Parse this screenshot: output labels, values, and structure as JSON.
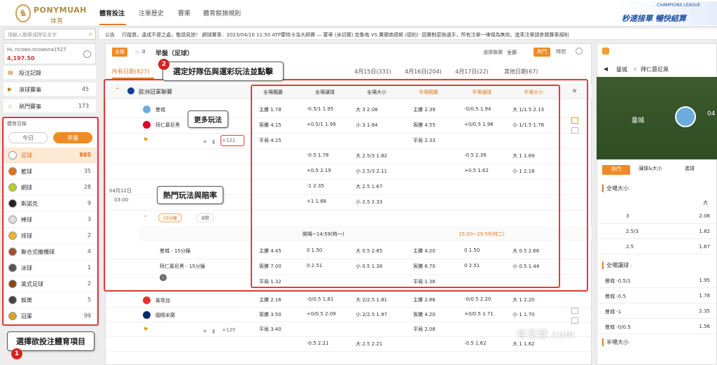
{
  "nav": {
    "brand": "PONYMUAH",
    "brand_sub": "体育",
    "links": [
      "體育投注",
      "注單歷史",
      "賽果",
      "體育競猜規則"
    ],
    "promo_text": "秒速接單 暢快結算",
    "promo_badge": "CHAMPIONS LEAGUE"
  },
  "search": {
    "placeholder": "請輸入聯賽或隊伍名字"
  },
  "announcement": {
    "label": "公告",
    "text": "行蹤異，違成不便之處，敬請見諒！  網球賽事：2023/04/10 11:50 ATP蒙特卡洛大師賽 — 蒙蒂 (米切爾) 克魯格 VS 費爾南德斯 (德約) ·因賽制更換選手，所有注單一律視為無效。進率注單請參閱賽事規則"
  },
  "user": {
    "name": "Hi, ncows-ncowsnа1527",
    "balance": "4,197.50"
  },
  "sidebar": {
    "items": [
      {
        "label": "投注記錄",
        "count": ""
      },
      {
        "label": "滾球賽事",
        "count": "45"
      },
      {
        "label": "熱門賽事",
        "count": "173"
      }
    ],
    "sports_title": "體育目錄",
    "toggle_today": "今日",
    "toggle_early": "早盤",
    "sports": [
      {
        "label": "足球",
        "count": "885",
        "color": "#ffffff"
      },
      {
        "label": "籃球",
        "count": "35",
        "color": "#e0721a"
      },
      {
        "label": "網球",
        "count": "28",
        "color": "#b6d12b"
      },
      {
        "label": "斯諾克",
        "count": "9",
        "color": "#222222"
      },
      {
        "label": "棒球",
        "count": "3",
        "color": "#dddddd"
      },
      {
        "label": "排球",
        "count": "2",
        "color": "#f0b429"
      },
      {
        "label": "聯合式橄欖球",
        "count": "4",
        "color": "#a0522d"
      },
      {
        "label": "冰球",
        "count": "1",
        "color": "#555555"
      },
      {
        "label": "美式足球",
        "count": "2",
        "color": "#8b4513"
      },
      {
        "label": "娛樂",
        "count": "5",
        "color": "#444444"
      },
      {
        "label": "冠軍",
        "count": "99",
        "color": "#d9a520"
      }
    ]
  },
  "main": {
    "tab_all": "全部",
    "star_count": "0",
    "section_title": "早盤（足球）",
    "sort_label": "選擇聯賽",
    "sort_value": "全部",
    "hot_btn": "熱門",
    "time_btn": "時間",
    "date_tabs": [
      "所有日期(827)",
      "4月15日(331)",
      "4月16日(204)",
      "4月17日(22)",
      "其他日期(67)"
    ],
    "league": "歐洲冠軍聯賽",
    "columns": [
      "全場獨贏",
      "全場讓球",
      "全場大小",
      "半場獨贏",
      "半場讓球",
      "半場大小"
    ],
    "home_team": "曼城",
    "away_team": "拜仁慕尼黑",
    "draw": "平局",
    "more_count": "+121",
    "match_date": "04月12日",
    "match_time": "03:00",
    "rows": [
      [
        "主勝 1.78",
        "-0.5/1 1.95",
        "大 3 2.08",
        "主勝 2.39",
        "-0/0.5 1.94",
        "大 1/1.5 2.13"
      ],
      [
        "客勝 4.15",
        "+0.5/1 1.99",
        "小 3 1.84",
        "客勝 4.55",
        "+0/0.5 1.96",
        "小 1/1.5 1.78"
      ],
      [
        "平局 4.15",
        "",
        "",
        "平局 2.33",
        "",
        ""
      ],
      [
        "",
        "-0.5 1.78",
        "大 2.5/3 1.82",
        "",
        "-0.5 2.38",
        "大 1 1.69"
      ],
      [
        "",
        "+0.5 2.19",
        "小 2.5/3 2.11",
        "",
        "+0.5 1.62",
        "小 1 2.18"
      ],
      [
        "",
        "-1 2.35",
        "大 2.5 1.67",
        "",
        "",
        ""
      ],
      [
        "",
        "+1 1.68",
        "小 2.5 2.33",
        "",
        "",
        ""
      ]
    ],
    "pill_15": "15分鐘",
    "pill_more": "波膽",
    "period1": "開場~14:59(特一)",
    "period2": "15:00~29:59(特二)",
    "sub_home": "曼城 - 15分鐘",
    "sub_away": "拜仁慕尼黑 - 15分鐘",
    "sub_rows": [
      [
        "主勝 4.45",
        "0 1.50",
        "大 0.5 2.85",
        "主勝 4.20",
        "0 1.50",
        "大 0.5 2.66"
      ],
      [
        "客勝 7.00",
        "0 2.51",
        "小 0.5 1.38",
        "客勝 6.70",
        "0 2.51",
        "小 0.5 1.44"
      ],
      [
        "平局 1.32",
        "",
        "",
        "平局 1.36",
        "",
        ""
      ]
    ],
    "next_home": "賓菲加",
    "next_away": "國際米蘭",
    "next_more": "+125",
    "next_rows": [
      [
        "主勝 2.16",
        "-0/0.5 1.81",
        "大 2/2.5 1.81",
        "主勝 2.86",
        "-0/0.5 2.20",
        "大 1 2.20"
      ],
      [
        "客勝 3.50",
        "+0/0.5 2.09",
        "小 2/2.5 1.97",
        "客勝 4.20",
        "+0/0.5 1.71",
        "小 1 1.70"
      ],
      [
        "平局 3.40",
        "",
        "",
        "平局 2.08",
        "",
        ""
      ],
      [
        "",
        "-0.5 2.21",
        "大 2.5 2.21",
        "",
        "-0.5 1.62",
        "大 1 1.62"
      ]
    ]
  },
  "annotations": {
    "step1": "選擇欲投注體育項目",
    "step2": "選定好隊伍與運彩玩法並點擊",
    "more": "更多玩法",
    "hot": "熱門玩法與賠率",
    "n1": "1",
    "n2": "2"
  },
  "right": {
    "home": "曼城",
    "vs": "v",
    "away": "拜仁慕尼黑",
    "pitch_team": "曼城",
    "pitch_date": "04",
    "tabs": [
      "熱門",
      "讓球&大小",
      "進球"
    ],
    "sec1": "全場大小",
    "sec1_head": "大",
    "sec1_rows": [
      [
        "3",
        "2.08"
      ],
      [
        "2.5/3",
        "1.82"
      ],
      [
        "2.5",
        "1.67"
      ]
    ],
    "sec2": "全場讓球",
    "sec2_rows": [
      [
        "曼城 -0.5/1",
        "1.95"
      ],
      [
        "曼城 -0.5",
        "1.78"
      ],
      [
        "曼城 -1",
        "2.35"
      ],
      [
        "曼城 -0/0.5",
        "1.56"
      ]
    ],
    "sec3": "半場大小"
  },
  "watermark": "世足賽.com"
}
